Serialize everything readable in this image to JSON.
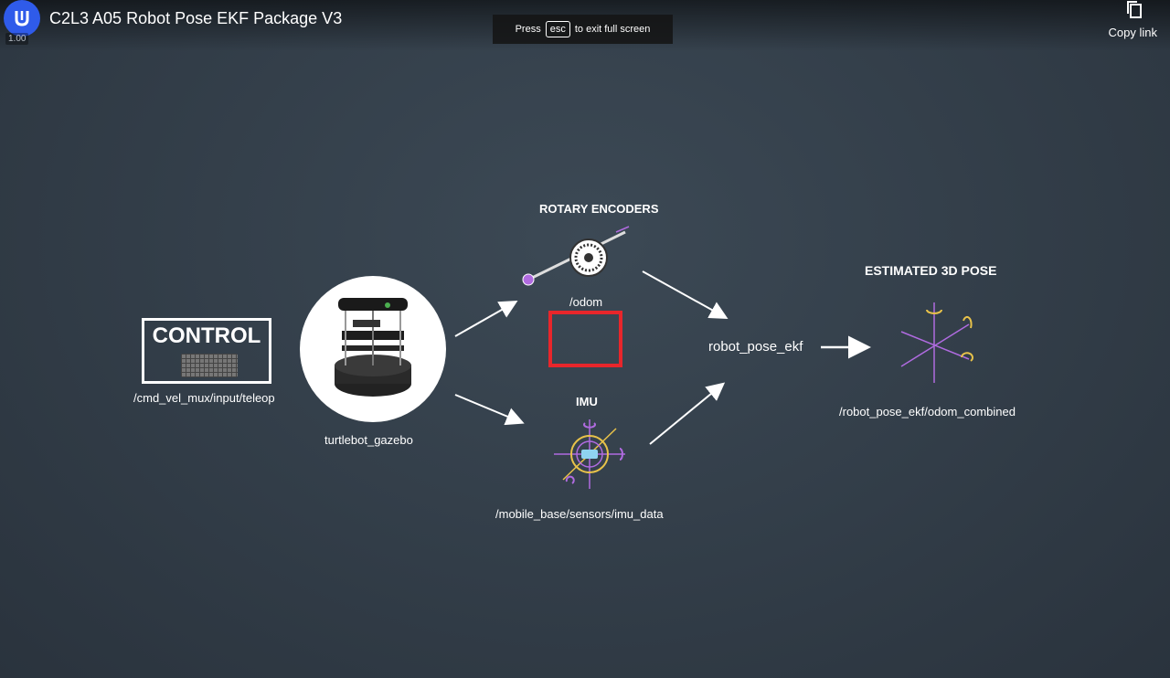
{
  "header": {
    "title": "C2L3 A05 Robot Pose EKF Package V3",
    "speed": "1.00",
    "logo_icon": "udacity-logo-icon"
  },
  "fullscreen_notice": {
    "press": "Press",
    "key": "esc",
    "rest": "to exit full screen"
  },
  "copy_link": {
    "label": "Copy link",
    "icon": "copy-icon"
  },
  "diagram": {
    "control_label": "CONTROL",
    "control_topic": "/cmd_vel_mux/input/teleop",
    "robot_label": "turtlebot_gazebo",
    "encoders_heading": "ROTARY ENCODERS",
    "odom_topic": "/odom",
    "imu_heading": "IMU",
    "imu_topic": "/mobile_base/sensors/imu_data",
    "ekf_node": "robot_pose_ekf",
    "pose_heading": "ESTIMATED 3D POSE",
    "pose_topic": "/robot_pose_ekf/odom_combined"
  },
  "colors": {
    "background": "#36424d",
    "highlight": "#e8262b",
    "accent": "#b06be0",
    "logo": "#2f5bea"
  }
}
